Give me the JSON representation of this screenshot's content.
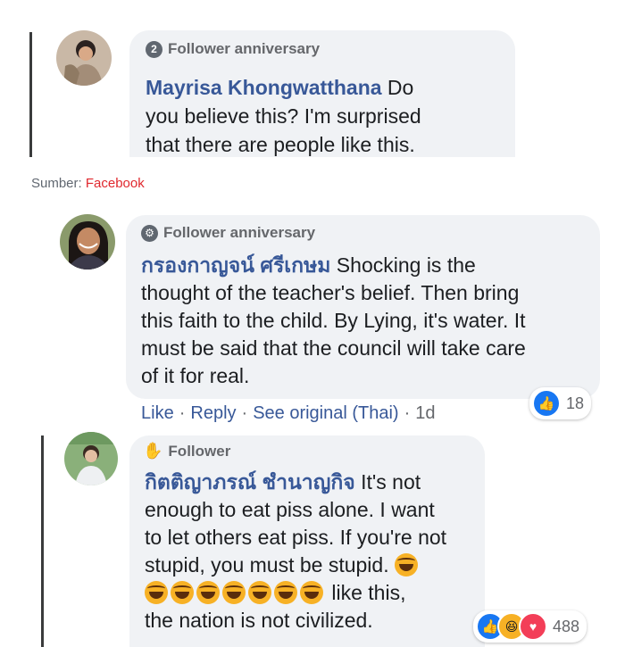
{
  "comments": [
    {
      "badge": "Follower anniversary",
      "badge_icon": "2",
      "author": "Mayrisa Khongwatthana",
      "lines": [
        " Do",
        "you believe this? I'm surprised",
        "that there are people like this."
      ]
    },
    {
      "badge": "Follower anniversary",
      "badge_icon": "gear-icon",
      "author": "กรองกาญจน์ ศรีเกษม",
      "lines": [
        " Shocking is the",
        "thought of the teacher's belief. Then bring",
        "this faith to the child. By Lying, it's water. It",
        "must be said that the council will take care",
        "of it for real."
      ],
      "reactions": {
        "icons": [
          "like-icon"
        ],
        "count": "18"
      }
    },
    {
      "badge": "Follower",
      "badge_icon": "wave-hand-icon",
      "author": "กิตติญาภรณ์ ชำนาญกิจ",
      "lines": [
        " It's not",
        "enough to eat piss alone. I want",
        "to let others eat piss. If you're not",
        "stupid, you must be stupid. "
      ],
      "emoji_line_suffix": " like this,",
      "last_line": "the nation is not civilized.",
      "reactions": {
        "icons": [
          "like-icon",
          "haha-icon",
          "love-icon"
        ],
        "count": "488"
      }
    }
  ],
  "source": {
    "label": "Sumber: ",
    "link": "Facebook"
  },
  "actions": {
    "like": "Like",
    "reply": "Reply",
    "see_original": "See original (Thai)",
    "sep": "·",
    "time": "1d"
  },
  "colors": {
    "author": "#385898",
    "bubble": "#f0f2f5",
    "source_link": "#e0282e",
    "like_blue": "#1877f2"
  }
}
